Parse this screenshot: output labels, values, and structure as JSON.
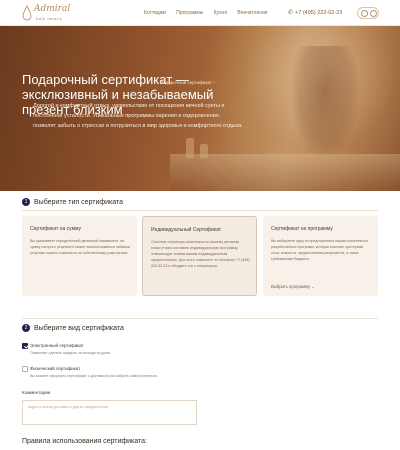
{
  "header": {
    "logo_title": "Admiral",
    "logo_sub": "bath dmaris",
    "nav": [
      "Коттеджи",
      "Программы",
      "Кухня",
      "Впечатления"
    ],
    "phone": "+7 (495) 222-02-23"
  },
  "hero": {
    "title": "Подарочный сертификат — эксклюзивный и незабываемый презент близким",
    "breadcrumb": "Подарочный сертификат",
    "text": "Дорогой и комфортный отдых, удовольствие от посещения вечной суеты и постоянной усталости. Уникальные программы парения и оздоровления позволят забыть о стрессах и погрузиться в мир здоровья и комфортного отдыха."
  },
  "step1": {
    "number": "1",
    "title": "Выберите тип сертификата",
    "cards": [
      {
        "title": "Сертификат на сумму",
        "text": "Вы указываете определённый денежный эквивалент, на сумму которого рецепиент может воспользоваться любыми услугами нашего комплекса по собственному усмотрению."
      },
      {
        "title": "Индивидуальный Сертификат",
        "text": "Опытные операторы комплекса по вашему желанию помогут вам составить индивидуальную программу, отвечающую тонким вашим индивидуальным предпочтениям. Для этого позвоните по телефону",
        "phone": "+7 (495) 222-02-23",
        "text_after": "и обсудите это с оператором."
      },
      {
        "title": "Сертификат на программу",
        "text": "Вы выбираете одну из предложенных нашим комплексом разработанных программ, которая отвечает критериям пола, возраста, предпочтениям рецепиента, а также требованиям бюджета.",
        "link": "Выбрать программу"
      }
    ]
  },
  "step2": {
    "number": "2",
    "title": "Выберите вид сертификата",
    "options": [
      {
        "title": "Электронный сертификат",
        "desc": "Позволяет сделать подарок, не выходя из дома.",
        "checked": true
      },
      {
        "title": "Физический сертификат",
        "desc": "Вы можете оформить сертификат с доставкой или забрать самостоятельно.",
        "checked": false
      }
    ],
    "comment_label": "Комментарии",
    "comment_placeholder": "Адрес и время доставки и другие предпочтения"
  },
  "rules_title": "Правила использования сертификата:",
  "colors": {
    "accent_dark": "#23204a",
    "accent_gold": "#b08a5e",
    "card_bg": "#f7f1ea"
  }
}
